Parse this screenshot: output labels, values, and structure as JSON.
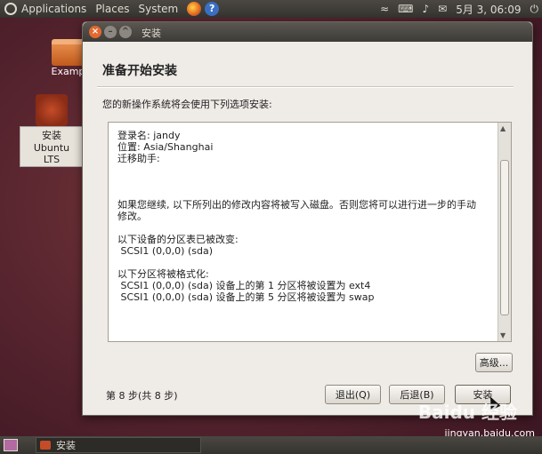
{
  "top_panel": {
    "menus": [
      "Applications",
      "Places",
      "System"
    ],
    "clock": "5月 3, 06:09"
  },
  "desktop": {
    "icons": [
      {
        "label": "Exampl"
      },
      {
        "label_line1": "安装 Ubuntu",
        "label_line2": "LTS"
      }
    ]
  },
  "window": {
    "title": "安装",
    "controls": {
      "close": "×",
      "minimize": "–",
      "maximize": "^"
    },
    "header": "准备开始安装",
    "intro": "您的新操作系统将会使用下列选项安装:",
    "summary_text": "登录名: jandy\n位置: Asia/Shanghai\n迁移助手:\n\n\n\n如果您继续, 以下所列出的修改内容将被写入磁盘。否则您将可以进行进一步的手动\n修改。\n\n以下设备的分区表已被改变:\n SCSI1 (0,0,0) (sda)\n\n以下分区将被格式化:\n SCSI1 (0,0,0) (sda) 设备上的第 1 分区将被设置为 ext4\n SCSI1 (0,0,0) (sda) 设备上的第 5 分区将被设置为 swap",
    "advanced_button": "高级...",
    "step_label": "第 8 步(共 8 步)",
    "quit_button": "退出(Q)",
    "back_button": "后退(B)",
    "install_button": "安装"
  },
  "bottom_panel": {
    "task_label": "安装"
  },
  "watermark": {
    "logo": "Baidu 经验",
    "url": "jingyan.baidu.com"
  },
  "colors": {
    "panel": "#3d3b37",
    "window_bg": "#efebe7",
    "close_button": "#e3682f"
  },
  "icons": {
    "ubuntu": "ubuntu-logo-icon",
    "firefox": "firefox-icon",
    "help": "help-icon",
    "network": "wifi-icon",
    "keyboard": "keyboard-icon",
    "volume": "volume-icon",
    "mail": "mail-icon",
    "power": "power-icon"
  }
}
